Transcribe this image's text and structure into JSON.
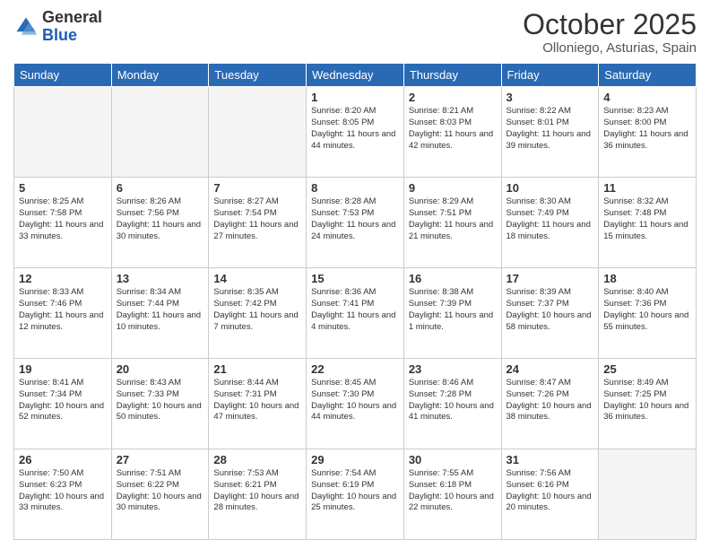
{
  "header": {
    "logo_general": "General",
    "logo_blue": "Blue",
    "month": "October 2025",
    "location": "Olloniego, Asturias, Spain"
  },
  "weekdays": [
    "Sunday",
    "Monday",
    "Tuesday",
    "Wednesday",
    "Thursday",
    "Friday",
    "Saturday"
  ],
  "weeks": [
    [
      {
        "day": "",
        "sunrise": "",
        "sunset": "",
        "daylight": ""
      },
      {
        "day": "",
        "sunrise": "",
        "sunset": "",
        "daylight": ""
      },
      {
        "day": "",
        "sunrise": "",
        "sunset": "",
        "daylight": ""
      },
      {
        "day": "1",
        "sunrise": "Sunrise: 8:20 AM",
        "sunset": "Sunset: 8:05 PM",
        "daylight": "Daylight: 11 hours and 44 minutes."
      },
      {
        "day": "2",
        "sunrise": "Sunrise: 8:21 AM",
        "sunset": "Sunset: 8:03 PM",
        "daylight": "Daylight: 11 hours and 42 minutes."
      },
      {
        "day": "3",
        "sunrise": "Sunrise: 8:22 AM",
        "sunset": "Sunset: 8:01 PM",
        "daylight": "Daylight: 11 hours and 39 minutes."
      },
      {
        "day": "4",
        "sunrise": "Sunrise: 8:23 AM",
        "sunset": "Sunset: 8:00 PM",
        "daylight": "Daylight: 11 hours and 36 minutes."
      }
    ],
    [
      {
        "day": "5",
        "sunrise": "Sunrise: 8:25 AM",
        "sunset": "Sunset: 7:58 PM",
        "daylight": "Daylight: 11 hours and 33 minutes."
      },
      {
        "day": "6",
        "sunrise": "Sunrise: 8:26 AM",
        "sunset": "Sunset: 7:56 PM",
        "daylight": "Daylight: 11 hours and 30 minutes."
      },
      {
        "day": "7",
        "sunrise": "Sunrise: 8:27 AM",
        "sunset": "Sunset: 7:54 PM",
        "daylight": "Daylight: 11 hours and 27 minutes."
      },
      {
        "day": "8",
        "sunrise": "Sunrise: 8:28 AM",
        "sunset": "Sunset: 7:53 PM",
        "daylight": "Daylight: 11 hours and 24 minutes."
      },
      {
        "day": "9",
        "sunrise": "Sunrise: 8:29 AM",
        "sunset": "Sunset: 7:51 PM",
        "daylight": "Daylight: 11 hours and 21 minutes."
      },
      {
        "day": "10",
        "sunrise": "Sunrise: 8:30 AM",
        "sunset": "Sunset: 7:49 PM",
        "daylight": "Daylight: 11 hours and 18 minutes."
      },
      {
        "day": "11",
        "sunrise": "Sunrise: 8:32 AM",
        "sunset": "Sunset: 7:48 PM",
        "daylight": "Daylight: 11 hours and 15 minutes."
      }
    ],
    [
      {
        "day": "12",
        "sunrise": "Sunrise: 8:33 AM",
        "sunset": "Sunset: 7:46 PM",
        "daylight": "Daylight: 11 hours and 12 minutes."
      },
      {
        "day": "13",
        "sunrise": "Sunrise: 8:34 AM",
        "sunset": "Sunset: 7:44 PM",
        "daylight": "Daylight: 11 hours and 10 minutes."
      },
      {
        "day": "14",
        "sunrise": "Sunrise: 8:35 AM",
        "sunset": "Sunset: 7:42 PM",
        "daylight": "Daylight: 11 hours and 7 minutes."
      },
      {
        "day": "15",
        "sunrise": "Sunrise: 8:36 AM",
        "sunset": "Sunset: 7:41 PM",
        "daylight": "Daylight: 11 hours and 4 minutes."
      },
      {
        "day": "16",
        "sunrise": "Sunrise: 8:38 AM",
        "sunset": "Sunset: 7:39 PM",
        "daylight": "Daylight: 11 hours and 1 minute."
      },
      {
        "day": "17",
        "sunrise": "Sunrise: 8:39 AM",
        "sunset": "Sunset: 7:37 PM",
        "daylight": "Daylight: 10 hours and 58 minutes."
      },
      {
        "day": "18",
        "sunrise": "Sunrise: 8:40 AM",
        "sunset": "Sunset: 7:36 PM",
        "daylight": "Daylight: 10 hours and 55 minutes."
      }
    ],
    [
      {
        "day": "19",
        "sunrise": "Sunrise: 8:41 AM",
        "sunset": "Sunset: 7:34 PM",
        "daylight": "Daylight: 10 hours and 52 minutes."
      },
      {
        "day": "20",
        "sunrise": "Sunrise: 8:43 AM",
        "sunset": "Sunset: 7:33 PM",
        "daylight": "Daylight: 10 hours and 50 minutes."
      },
      {
        "day": "21",
        "sunrise": "Sunrise: 8:44 AM",
        "sunset": "Sunset: 7:31 PM",
        "daylight": "Daylight: 10 hours and 47 minutes."
      },
      {
        "day": "22",
        "sunrise": "Sunrise: 8:45 AM",
        "sunset": "Sunset: 7:30 PM",
        "daylight": "Daylight: 10 hours and 44 minutes."
      },
      {
        "day": "23",
        "sunrise": "Sunrise: 8:46 AM",
        "sunset": "Sunset: 7:28 PM",
        "daylight": "Daylight: 10 hours and 41 minutes."
      },
      {
        "day": "24",
        "sunrise": "Sunrise: 8:47 AM",
        "sunset": "Sunset: 7:26 PM",
        "daylight": "Daylight: 10 hours and 38 minutes."
      },
      {
        "day": "25",
        "sunrise": "Sunrise: 8:49 AM",
        "sunset": "Sunset: 7:25 PM",
        "daylight": "Daylight: 10 hours and 36 minutes."
      }
    ],
    [
      {
        "day": "26",
        "sunrise": "Sunrise: 7:50 AM",
        "sunset": "Sunset: 6:23 PM",
        "daylight": "Daylight: 10 hours and 33 minutes."
      },
      {
        "day": "27",
        "sunrise": "Sunrise: 7:51 AM",
        "sunset": "Sunset: 6:22 PM",
        "daylight": "Daylight: 10 hours and 30 minutes."
      },
      {
        "day": "28",
        "sunrise": "Sunrise: 7:53 AM",
        "sunset": "Sunset: 6:21 PM",
        "daylight": "Daylight: 10 hours and 28 minutes."
      },
      {
        "day": "29",
        "sunrise": "Sunrise: 7:54 AM",
        "sunset": "Sunset: 6:19 PM",
        "daylight": "Daylight: 10 hours and 25 minutes."
      },
      {
        "day": "30",
        "sunrise": "Sunrise: 7:55 AM",
        "sunset": "Sunset: 6:18 PM",
        "daylight": "Daylight: 10 hours and 22 minutes."
      },
      {
        "day": "31",
        "sunrise": "Sunrise: 7:56 AM",
        "sunset": "Sunset: 6:16 PM",
        "daylight": "Daylight: 10 hours and 20 minutes."
      },
      {
        "day": "",
        "sunrise": "",
        "sunset": "",
        "daylight": ""
      }
    ]
  ]
}
